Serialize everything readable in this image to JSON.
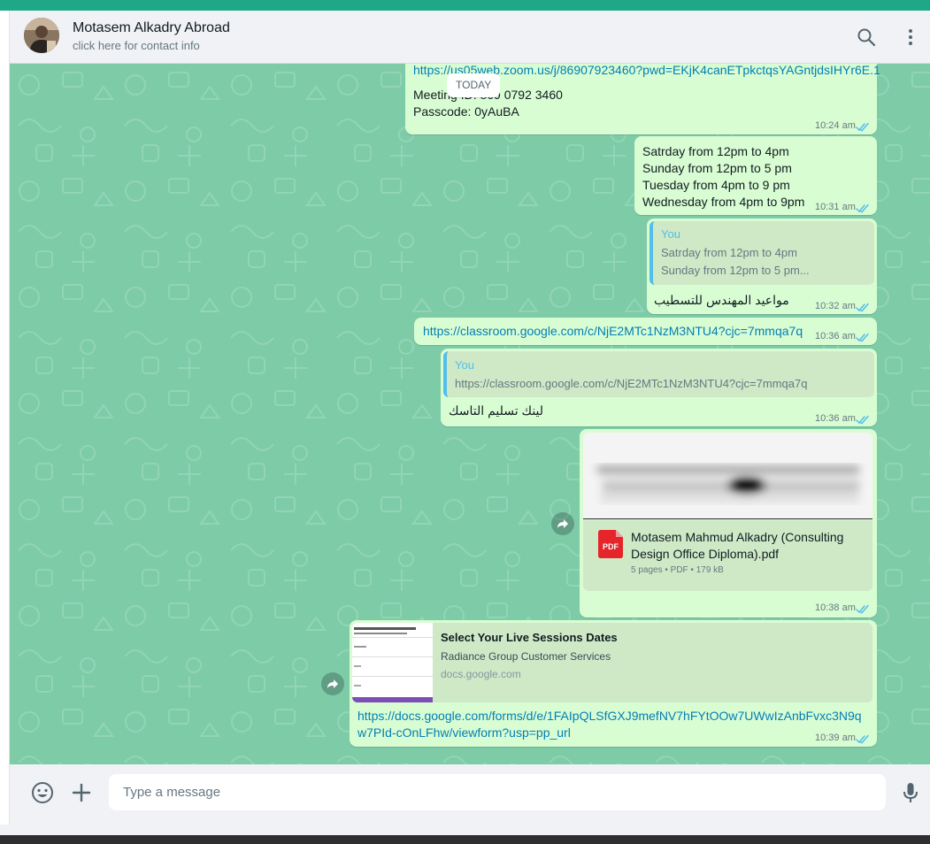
{
  "header": {
    "contact_name": "Motasem Alkadry Abroad",
    "contact_subtitle": "click here for contact info",
    "icons": [
      "search-icon",
      "menu-icon"
    ]
  },
  "date_divider": "TODAY",
  "messages": [
    {
      "lines": [
        "https://us05web.zoom.us/j/86907923460?pwd=EKjK4canETpkctqsYAGntjdsIHYr6E.1",
        "Meeting ID: 869 0792 3460",
        "Passcode: 0yAuBA"
      ],
      "time": "10:24 am"
    },
    {
      "lines": [
        "Satrday from 12pm to 4pm",
        "Sunday from 12pm to 5 pm",
        "Tuesday from 4pm to 9 pm",
        "Wednesday from 4pm to 9pm"
      ],
      "time": "10:31 am"
    },
    {
      "quote": {
        "author": "You",
        "lines": [
          "Satrday from 12pm to 4pm",
          "Sunday from 12pm to 5 pm..."
        ]
      },
      "text": "مواعيد المهندس للتسطيب",
      "time": "10:32 am"
    },
    {
      "text": "https://classroom.google.com/c/NjE2MTc1NzM3NTU4?cjc=7mmqa7q",
      "time": "10:36 am"
    },
    {
      "quote": {
        "author": "You",
        "lines": [
          "https://classroom.google.com/c/NjE2MTc1NzM3NTU4?cjc=7mmqa7q"
        ]
      },
      "text": "لينك تسليم التاسك",
      "time": "10:36 am"
    },
    {
      "document": {
        "icon_label": "PDF",
        "name": "Motasem Mahmud Alkadry (Consulting Design Office Diploma).pdf",
        "info": "5 pages • PDF • 179 kB"
      },
      "time": "10:38 am"
    },
    {
      "link_preview": {
        "title": "Select Your Live Sessions Dates",
        "description": "Radiance Group Customer Services",
        "domain": "docs.google.com"
      },
      "lines": [
        "https://docs.google.com/forms/d/e/1FAIpQLSfGXJ9mefNV7hFYtOOw7UWwIzAnbFvxc3N9q",
        "w7PId-cOnLFhw/viewform?usp=pp_url"
      ],
      "time": "10:39 am"
    }
  ],
  "composer": {
    "placeholder": "Type a message",
    "icons": [
      "emoji-icon",
      "attach-plus-icon",
      "microphone-icon"
    ]
  },
  "colors": {
    "accent": "#1fa887",
    "chat_background": "#7ecba8",
    "outgoing_bubble": "#d9fdd3",
    "link": "#027eb5",
    "read_ticks": "#53bdeb"
  }
}
